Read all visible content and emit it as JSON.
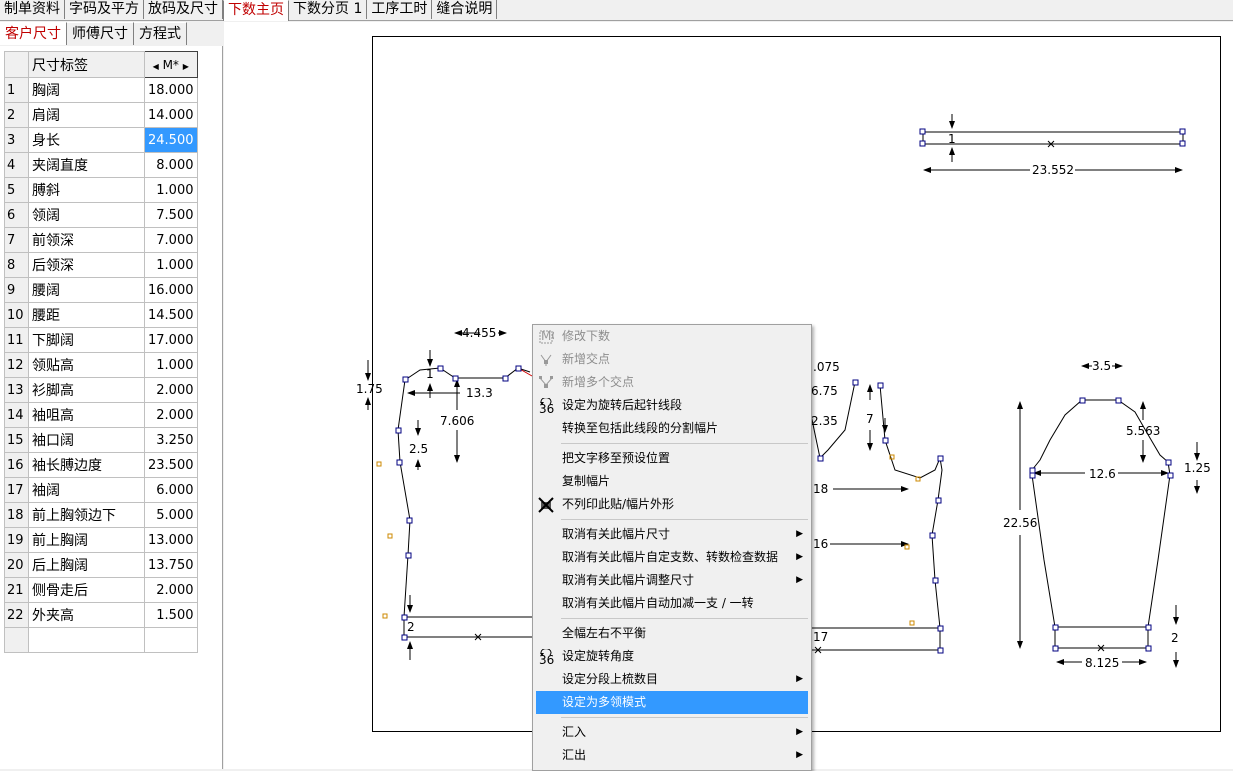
{
  "top_tabs": [
    "制单资料",
    "字码及平方",
    "放码及尺寸",
    "下数主页",
    "下数分页 1",
    "工序工时",
    "缝合说明"
  ],
  "active_top_tab": "下数主页",
  "sub_tabs": [
    "客户尺寸",
    "师傅尺寸",
    "方程式"
  ],
  "active_sub_tab": "客户尺寸",
  "grid": {
    "header_label": "尺寸标签",
    "header_size": "M*",
    "rows": [
      {
        "n": "1",
        "label": "胸阔",
        "value": "18.000"
      },
      {
        "n": "2",
        "label": "肩阔",
        "value": "14.000"
      },
      {
        "n": "3",
        "label": "身长",
        "value": "24.500"
      },
      {
        "n": "4",
        "label": "夹阔直度",
        "value": "8.000"
      },
      {
        "n": "5",
        "label": "膊斜",
        "value": "1.000"
      },
      {
        "n": "6",
        "label": "领阔",
        "value": "7.500"
      },
      {
        "n": "7",
        "label": "前领深",
        "value": "7.000"
      },
      {
        "n": "8",
        "label": "后领深",
        "value": "1.000"
      },
      {
        "n": "9",
        "label": "腰阔",
        "value": "16.000"
      },
      {
        "n": "10",
        "label": "腰距",
        "value": "14.500"
      },
      {
        "n": "11",
        "label": "下脚阔",
        "value": "17.000"
      },
      {
        "n": "12",
        "label": "领贴高",
        "value": "1.000"
      },
      {
        "n": "13",
        "label": "衫脚高",
        "value": "2.000"
      },
      {
        "n": "14",
        "label": "袖咀高",
        "value": "2.000"
      },
      {
        "n": "15",
        "label": "袖口阔",
        "value": "3.250"
      },
      {
        "n": "16",
        "label": "袖长膊边度",
        "value": "23.500"
      },
      {
        "n": "17",
        "label": "袖阔",
        "value": "6.000"
      },
      {
        "n": "18",
        "label": "前上胸领边下",
        "value": "5.000"
      },
      {
        "n": "19",
        "label": "前上胸阔",
        "value": "13.000"
      },
      {
        "n": "20",
        "label": "后上胸阔",
        "value": "13.750"
      },
      {
        "n": "21",
        "label": "侧骨走后",
        "value": "2.000"
      },
      {
        "n": "22",
        "label": "外夹高",
        "value": "1.500"
      }
    ],
    "selected_row": "3"
  },
  "drawing_labels": {
    "strip_count": "1",
    "strip_width": "23.552",
    "back_width_top": "4.455",
    "back_side": "1.75",
    "back_collar": "1",
    "back_shoulder": "13.3",
    "back_armhole": "7.606",
    "back_arm_depth": "2.5",
    "back_hem": "2",
    "front_top": ".075",
    "front_a": "6.75",
    "front_b": "2.35",
    "front_c": "7",
    "front_d": "18",
    "front_e": "16",
    "front_f": "17",
    "sleeve_cap": "3.5",
    "sleeve_cap_h": "5.563",
    "sleeve_width": "12.6",
    "sleeve_side": "1.25",
    "sleeve_length": "22.56",
    "sleeve_cuff_h": "2",
    "sleeve_cuff": "8.125"
  },
  "context_menu": [
    {
      "label": "修改下数",
      "disabled": true,
      "icon": "edit-count-icon"
    },
    {
      "label": "新增交点",
      "disabled": true,
      "icon": "add-point-icon"
    },
    {
      "label": "新增多个交点",
      "disabled": true,
      "icon": "add-points-icon"
    },
    {
      "label": "设定为旋转后起针线段",
      "disabled": false,
      "icon": "rotate-360-icon"
    },
    {
      "label": "转换至包括此线段的分割幅片",
      "disabled": false
    },
    {
      "sep": true
    },
    {
      "label": "把文字移至预设位置",
      "disabled": false
    },
    {
      "label": "复制幅片",
      "disabled": false
    },
    {
      "label": "不列印此贴/幅片外形",
      "disabled": false,
      "icon": "no-print-icon"
    },
    {
      "sep": true
    },
    {
      "label": "取消有关此幅片尺寸",
      "disabled": false,
      "submenu": true
    },
    {
      "label": "取消有关此幅片自定支数、转数检查数据",
      "disabled": false,
      "submenu": true
    },
    {
      "label": "取消有关此幅片调整尺寸",
      "disabled": false,
      "submenu": true
    },
    {
      "label": "取消有关此幅片自动加减一支 / 一转",
      "disabled": false
    },
    {
      "sep": true
    },
    {
      "label": "全幅左右不平衡",
      "disabled": false
    },
    {
      "label": "设定旋转角度",
      "disabled": false,
      "icon": "rotate-360-icon"
    },
    {
      "label": "设定分段上梳数目",
      "disabled": false,
      "submenu": true
    },
    {
      "label": "设定为多领模式",
      "disabled": false,
      "highlight": true
    },
    {
      "sep": true
    },
    {
      "label": "汇入",
      "disabled": false,
      "submenu": true
    },
    {
      "label": "汇出",
      "disabled": false,
      "submenu": true
    }
  ],
  "colors": {
    "active_tab_text": "#c00000",
    "selection": "#3399ff",
    "point": "#000080",
    "marker": "#cc8800"
  }
}
